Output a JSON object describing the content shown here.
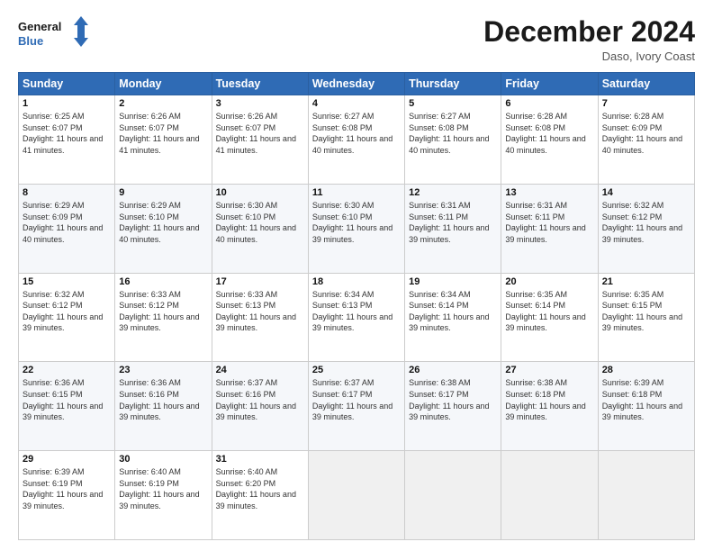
{
  "header": {
    "logo_line1": "General",
    "logo_line2": "Blue",
    "month_title": "December 2024",
    "location": "Daso, Ivory Coast"
  },
  "days_of_week": [
    "Sunday",
    "Monday",
    "Tuesday",
    "Wednesday",
    "Thursday",
    "Friday",
    "Saturday"
  ],
  "weeks": [
    [
      {
        "day": "1",
        "sunrise": "6:25 AM",
        "sunset": "6:07 PM",
        "daylight": "11 hours and 41 minutes."
      },
      {
        "day": "2",
        "sunrise": "6:26 AM",
        "sunset": "6:07 PM",
        "daylight": "11 hours and 41 minutes."
      },
      {
        "day": "3",
        "sunrise": "6:26 AM",
        "sunset": "6:07 PM",
        "daylight": "11 hours and 41 minutes."
      },
      {
        "day": "4",
        "sunrise": "6:27 AM",
        "sunset": "6:08 PM",
        "daylight": "11 hours and 40 minutes."
      },
      {
        "day": "5",
        "sunrise": "6:27 AM",
        "sunset": "6:08 PM",
        "daylight": "11 hours and 40 minutes."
      },
      {
        "day": "6",
        "sunrise": "6:28 AM",
        "sunset": "6:08 PM",
        "daylight": "11 hours and 40 minutes."
      },
      {
        "day": "7",
        "sunrise": "6:28 AM",
        "sunset": "6:09 PM",
        "daylight": "11 hours and 40 minutes."
      }
    ],
    [
      {
        "day": "8",
        "sunrise": "6:29 AM",
        "sunset": "6:09 PM",
        "daylight": "11 hours and 40 minutes."
      },
      {
        "day": "9",
        "sunrise": "6:29 AM",
        "sunset": "6:10 PM",
        "daylight": "11 hours and 40 minutes."
      },
      {
        "day": "10",
        "sunrise": "6:30 AM",
        "sunset": "6:10 PM",
        "daylight": "11 hours and 40 minutes."
      },
      {
        "day": "11",
        "sunrise": "6:30 AM",
        "sunset": "6:10 PM",
        "daylight": "11 hours and 39 minutes."
      },
      {
        "day": "12",
        "sunrise": "6:31 AM",
        "sunset": "6:11 PM",
        "daylight": "11 hours and 39 minutes."
      },
      {
        "day": "13",
        "sunrise": "6:31 AM",
        "sunset": "6:11 PM",
        "daylight": "11 hours and 39 minutes."
      },
      {
        "day": "14",
        "sunrise": "6:32 AM",
        "sunset": "6:12 PM",
        "daylight": "11 hours and 39 minutes."
      }
    ],
    [
      {
        "day": "15",
        "sunrise": "6:32 AM",
        "sunset": "6:12 PM",
        "daylight": "11 hours and 39 minutes."
      },
      {
        "day": "16",
        "sunrise": "6:33 AM",
        "sunset": "6:12 PM",
        "daylight": "11 hours and 39 minutes."
      },
      {
        "day": "17",
        "sunrise": "6:33 AM",
        "sunset": "6:13 PM",
        "daylight": "11 hours and 39 minutes."
      },
      {
        "day": "18",
        "sunrise": "6:34 AM",
        "sunset": "6:13 PM",
        "daylight": "11 hours and 39 minutes."
      },
      {
        "day": "19",
        "sunrise": "6:34 AM",
        "sunset": "6:14 PM",
        "daylight": "11 hours and 39 minutes."
      },
      {
        "day": "20",
        "sunrise": "6:35 AM",
        "sunset": "6:14 PM",
        "daylight": "11 hours and 39 minutes."
      },
      {
        "day": "21",
        "sunrise": "6:35 AM",
        "sunset": "6:15 PM",
        "daylight": "11 hours and 39 minutes."
      }
    ],
    [
      {
        "day": "22",
        "sunrise": "6:36 AM",
        "sunset": "6:15 PM",
        "daylight": "11 hours and 39 minutes."
      },
      {
        "day": "23",
        "sunrise": "6:36 AM",
        "sunset": "6:16 PM",
        "daylight": "11 hours and 39 minutes."
      },
      {
        "day": "24",
        "sunrise": "6:37 AM",
        "sunset": "6:16 PM",
        "daylight": "11 hours and 39 minutes."
      },
      {
        "day": "25",
        "sunrise": "6:37 AM",
        "sunset": "6:17 PM",
        "daylight": "11 hours and 39 minutes."
      },
      {
        "day": "26",
        "sunrise": "6:38 AM",
        "sunset": "6:17 PM",
        "daylight": "11 hours and 39 minutes."
      },
      {
        "day": "27",
        "sunrise": "6:38 AM",
        "sunset": "6:18 PM",
        "daylight": "11 hours and 39 minutes."
      },
      {
        "day": "28",
        "sunrise": "6:39 AM",
        "sunset": "6:18 PM",
        "daylight": "11 hours and 39 minutes."
      }
    ],
    [
      {
        "day": "29",
        "sunrise": "6:39 AM",
        "sunset": "6:19 PM",
        "daylight": "11 hours and 39 minutes."
      },
      {
        "day": "30",
        "sunrise": "6:40 AM",
        "sunset": "6:19 PM",
        "daylight": "11 hours and 39 minutes."
      },
      {
        "day": "31",
        "sunrise": "6:40 AM",
        "sunset": "6:20 PM",
        "daylight": "11 hours and 39 minutes."
      },
      null,
      null,
      null,
      null
    ]
  ]
}
